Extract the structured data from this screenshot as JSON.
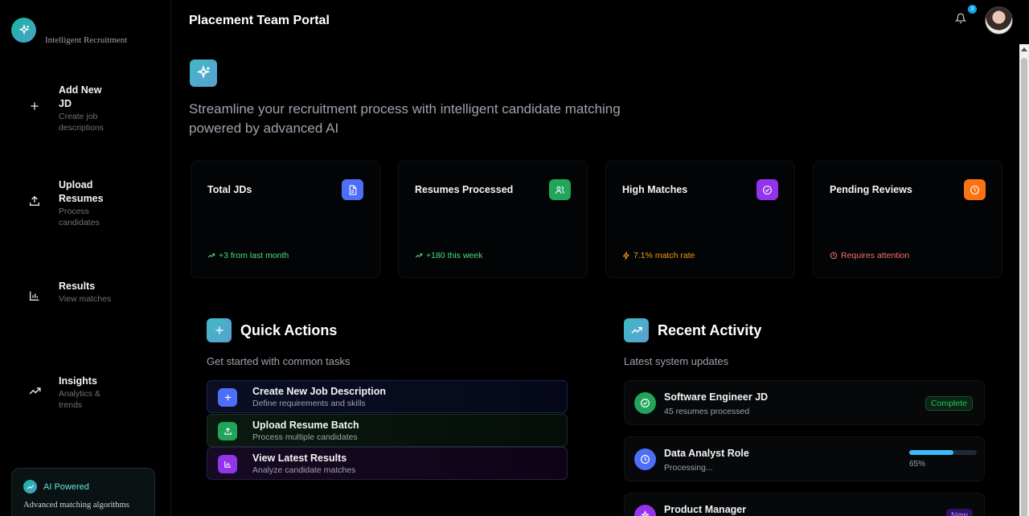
{
  "sidebar": {
    "logo_subtitle": "Intelligent Recruitment",
    "items": [
      {
        "title": "Add New JD",
        "desc": "Create job descriptions",
        "icon": "plus-icon"
      },
      {
        "title": "Upload Resumes",
        "desc": "Process candidates",
        "icon": "upload-icon"
      },
      {
        "title": "Results",
        "desc": "View matches",
        "icon": "bar-chart-icon"
      },
      {
        "title": "Insights",
        "desc": "Analytics & trends",
        "icon": "trending-up-icon"
      }
    ],
    "ai_box": {
      "title": "AI Powered",
      "desc": "Advanced matching algorithms"
    }
  },
  "header": {
    "title": "Placement Team Portal",
    "notification_count": "3"
  },
  "hero": {
    "text": "Streamline your recruitment process with intelligent candidate matching powered by advanced AI"
  },
  "stats": [
    {
      "title": "Total JDs",
      "footer": "+3 from last month",
      "color": "#4f6ef7",
      "footer_color": "#4ade80"
    },
    {
      "title": "Resumes Processed",
      "footer": "+180 this week",
      "color": "#22a55a",
      "footer_color": "#4ade80"
    },
    {
      "title": "High Matches",
      "footer": "7.1% match rate",
      "color": "#9333ea",
      "footer_color": "#f59e0b"
    },
    {
      "title": "Pending Reviews",
      "footer": "Requires attention",
      "color": "#f97316",
      "footer_color": "#f87171"
    }
  ],
  "quick_actions": {
    "title": "Quick Actions",
    "subtitle": "Get started with common tasks",
    "items": [
      {
        "title": "Create New Job Description",
        "desc": "Define requirements and skills"
      },
      {
        "title": "Upload Resume Batch",
        "desc": "Process multiple candidates"
      },
      {
        "title": "View Latest Results",
        "desc": "Analyze candidate matches"
      }
    ]
  },
  "recent_activity": {
    "title": "Recent Activity",
    "subtitle": "Latest system updates",
    "items": [
      {
        "title": "Software Engineer JD",
        "desc": "45 resumes processed",
        "status": "Complete"
      },
      {
        "title": "Data Analyst Role",
        "desc": "Processing...",
        "progress": 0.65,
        "progress_label": "65%"
      },
      {
        "title": "Product Manager",
        "status": "New"
      }
    ]
  },
  "colors": {
    "accent": "#3fb9c5",
    "background": "#000000"
  }
}
